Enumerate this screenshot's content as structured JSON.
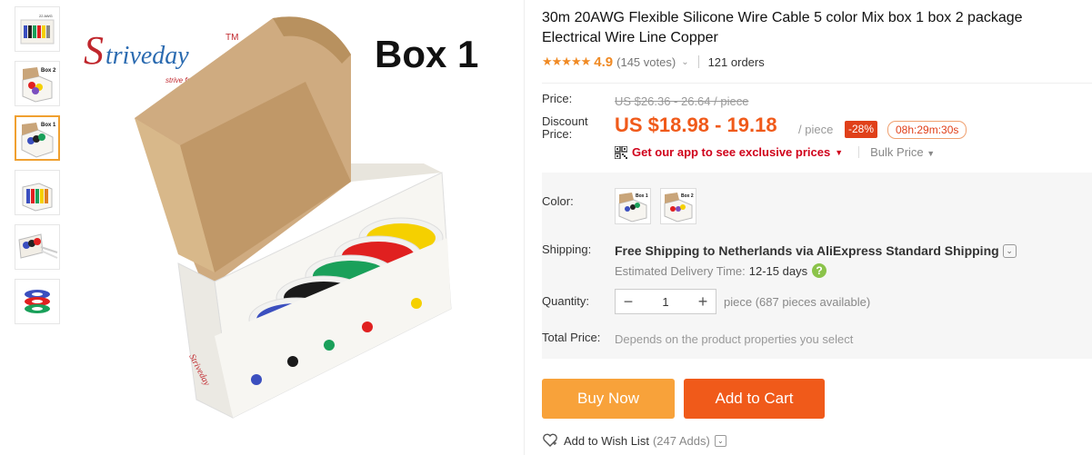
{
  "thumbnails": [
    {
      "name": "thumbnail-1"
    },
    {
      "name": "thumbnail-2",
      "label": "Box 2"
    },
    {
      "name": "thumbnail-3",
      "label": "Box 1",
      "active": true
    },
    {
      "name": "thumbnail-4"
    },
    {
      "name": "thumbnail-5"
    },
    {
      "name": "thumbnail-6"
    }
  ],
  "main_image": {
    "brand": "Striveday",
    "tm": "TM",
    "slogan": "strive for a better day!",
    "box_label": "Box 1",
    "box_brand": "Striveday"
  },
  "product": {
    "title": "30m 20AWG Flexible Silicone Wire Cable 5 color Mix box 1 box 2 package Electrical Wire Line Copper",
    "stars": "★★★★★",
    "rating": "4.9",
    "votes": "(145 votes)",
    "orders": "121 orders"
  },
  "price": {
    "price_label": "Price:",
    "original": "US $26.36 - 26.64 / piece",
    "discount_label": "Discount Price:",
    "discount_value": "US $18.98 - 19.18",
    "per_piece": "/ piece",
    "discount_badge": "-28%",
    "countdown": "08h:29m:30s",
    "app_promo": "Get our app to see exclusive prices",
    "bulk_price": "Bulk Price"
  },
  "options": {
    "color_label": "Color:",
    "color_swatches": [
      "Box 1",
      "Box 2"
    ],
    "shipping_label": "Shipping:",
    "shipping_main": "Free Shipping to Netherlands via AliExpress Standard Shipping",
    "delivery_label": "Estimated Delivery Time:",
    "delivery_days": "12-15 days",
    "quantity_label": "Quantity:",
    "quantity_value": "1",
    "quantity_note": "piece (687 pieces available)",
    "total_label": "Total Price:",
    "total_note": "Depends on the product properties you select"
  },
  "actions": {
    "buy_now": "Buy Now",
    "add_to_cart": "Add to Cart",
    "wishlist": "Add to Wish List",
    "wishlist_count": "(247 Adds)"
  },
  "colors": {
    "accent_orange": "#f05a1a",
    "buy_now": "#f8a23a",
    "star": "#f08a24",
    "promo_red": "#d0021b"
  }
}
